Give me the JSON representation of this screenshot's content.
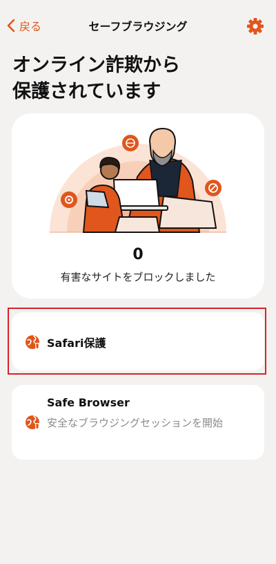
{
  "nav": {
    "back_label": "戻る",
    "title": "セーフブラウジング",
    "settings_icon": "gear-icon"
  },
  "headline": {
    "line1": "オンライン詐欺から",
    "line2": "保護されています"
  },
  "summary": {
    "blocked_count": "0",
    "blocked_label": "有害なサイトをブロックしました"
  },
  "protections": [
    {
      "title": "Safari保護",
      "icon": "globe-shield-icon"
    },
    {
      "title": "Safe Browser",
      "description": "安全なブラウジングセッションを開始",
      "icon": "globe-shield-icon"
    }
  ],
  "colors": {
    "accent": "#e0561c",
    "background": "#f3f2f1",
    "card": "#ffffff",
    "highlight": "#d8202a"
  }
}
